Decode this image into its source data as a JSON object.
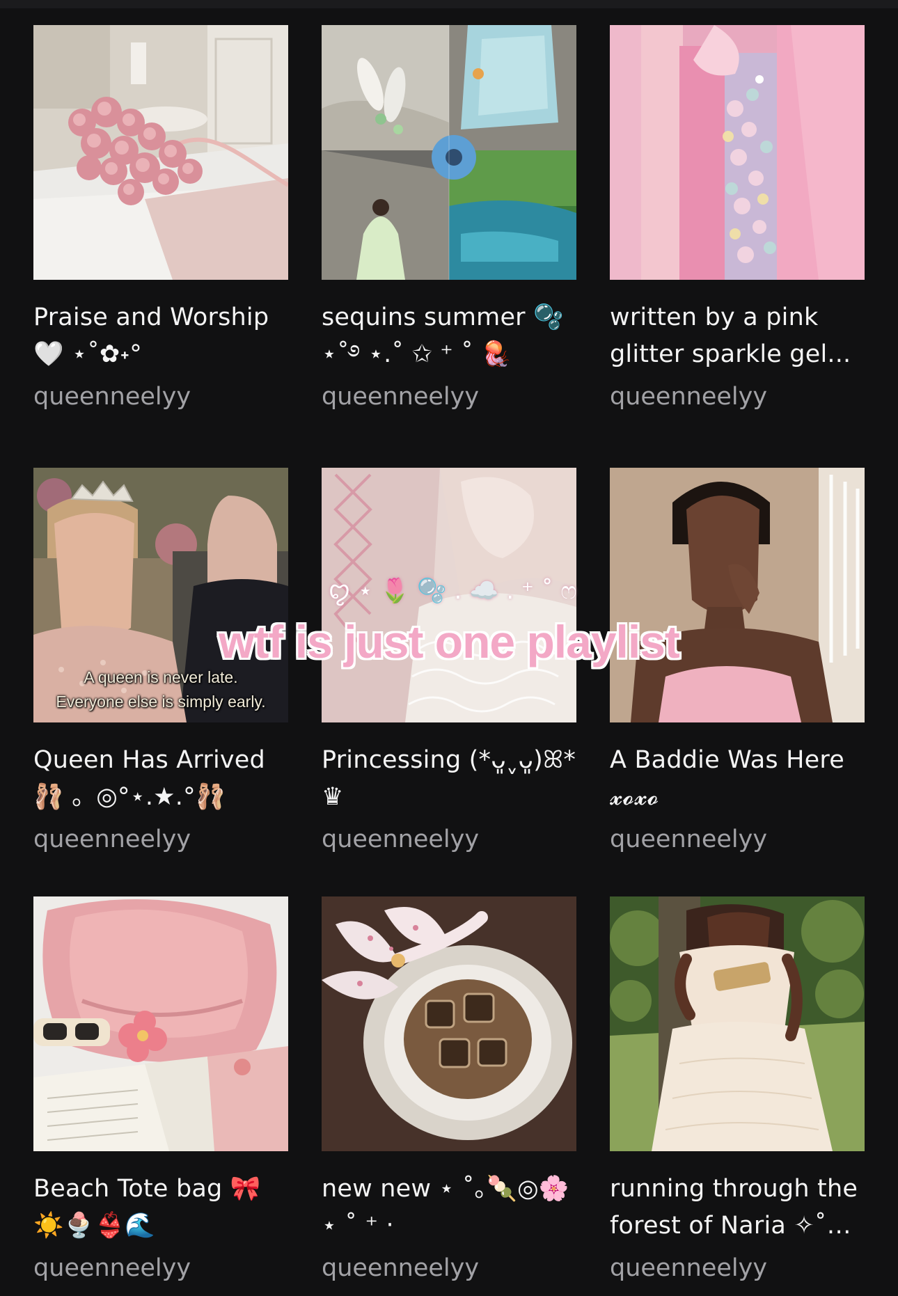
{
  "overlay": {
    "text": "wtf is just one playlist",
    "emoji_line": "ꨄ︎ ⋆ 🌷 🫧 . ☁️ . ⁺ ˚ ෆ"
  },
  "playlists": [
    {
      "title": "Praise and Worship 🤍 ⋆˚✿˖°",
      "owner": "queenneelyy"
    },
    {
      "title": "sequins summer 🫧 ⋆˚࿔ ⋆.˚ ✩ ⁺ ˚ 🪼",
      "owner": "queenneelyy"
    },
    {
      "title": "written by a pink glitter sparkle gel...",
      "owner": "queenneelyy"
    },
    {
      "title": "Queen Has Arrived 🩰 。◎°⋆.★.°🩰",
      "owner": "queenneelyy",
      "caption_line1": "A queen is never late.",
      "caption_line2": "Everyone else is simply early."
    },
    {
      "title": "Princessing (*ᴗ͈ˬᴗ͈)ꕤ* ♛",
      "owner": "queenneelyy"
    },
    {
      "title": "A Baddie Was Here 𝔁𝓸𝔁𝓸",
      "owner": "queenneelyy"
    },
    {
      "title": "Beach Tote bag 🎀 ☀️🍨👙🌊",
      "owner": "queenneelyy"
    },
    {
      "title": "new new ⋆ ˚｡🍡◎🌸⋆ ˚ ⁺ ‧",
      "owner": "queenneelyy"
    },
    {
      "title": "running through the forest of Naria ✧˚ ༘...",
      "owner": "queenneelyy"
    }
  ]
}
